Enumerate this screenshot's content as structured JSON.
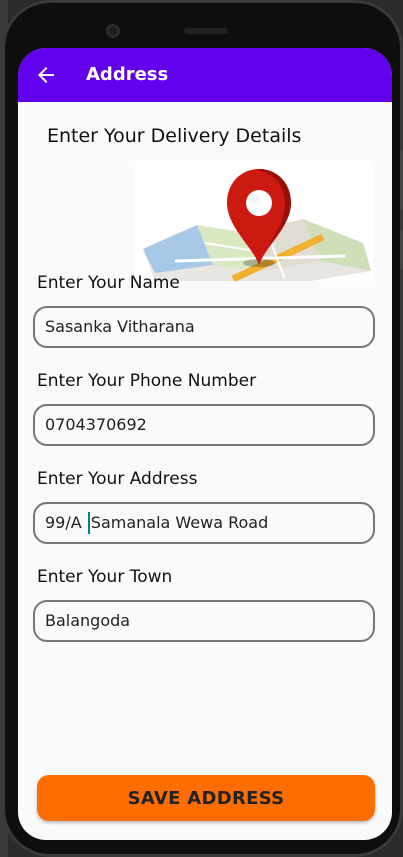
{
  "appbar": {
    "title": "Address",
    "back_icon": "arrow-left-icon",
    "color": "#6200ee"
  },
  "form": {
    "heading": "Enter Your Delivery Details",
    "image": "map-pin-illustration",
    "name": {
      "label": "Enter Your Name",
      "value": "Sasanka Vitharana"
    },
    "phone": {
      "label": "Enter Your Phone Number",
      "value": "0704370692"
    },
    "address": {
      "label": "Enter Your Address",
      "value_before_cursor": "99/A ",
      "value_after_cursor": "Samanala Wewa Road"
    },
    "town": {
      "label": "Enter Your Town",
      "value": "Balangoda"
    }
  },
  "save_button": {
    "label": "SAVE ADDRESS",
    "color": "#ff6d00"
  }
}
